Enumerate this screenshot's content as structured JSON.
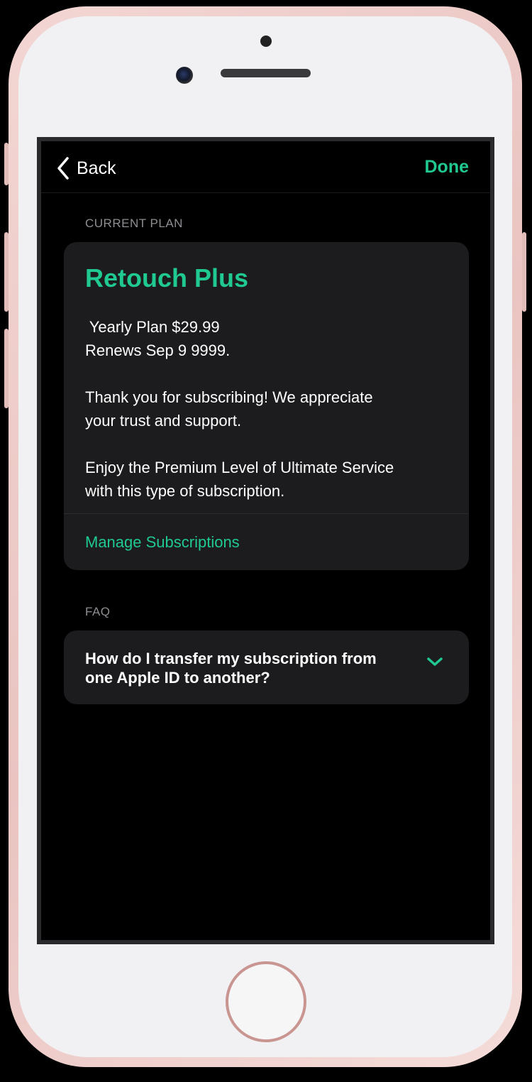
{
  "nav": {
    "back_label": "Back",
    "done_label": "Done"
  },
  "current_plan": {
    "section_label": "CURRENT PLAN",
    "title": "Retouch Plus",
    "plan_line": " Yearly Plan $29.99",
    "renew_line": "Renews Sep 9 9999.",
    "thanks_text": "Thank you for subscribing! We appreciate your trust and support.",
    "enjoy_text": "Enjoy the Premium Level of Ultimate Service with this type of subscription.",
    "manage_label": "Manage Subscriptions"
  },
  "faq": {
    "section_label": "FAQ",
    "items": [
      {
        "question": "How do I transfer my subscription from one Apple ID to another?"
      }
    ]
  },
  "colors": {
    "accent": "#1fc98f",
    "background": "#000000",
    "card": "#1c1c1e",
    "secondary_text": "#8e8e93"
  },
  "icons": {
    "back": "chevron-left-icon",
    "faq_expand": "chevron-down-icon"
  }
}
